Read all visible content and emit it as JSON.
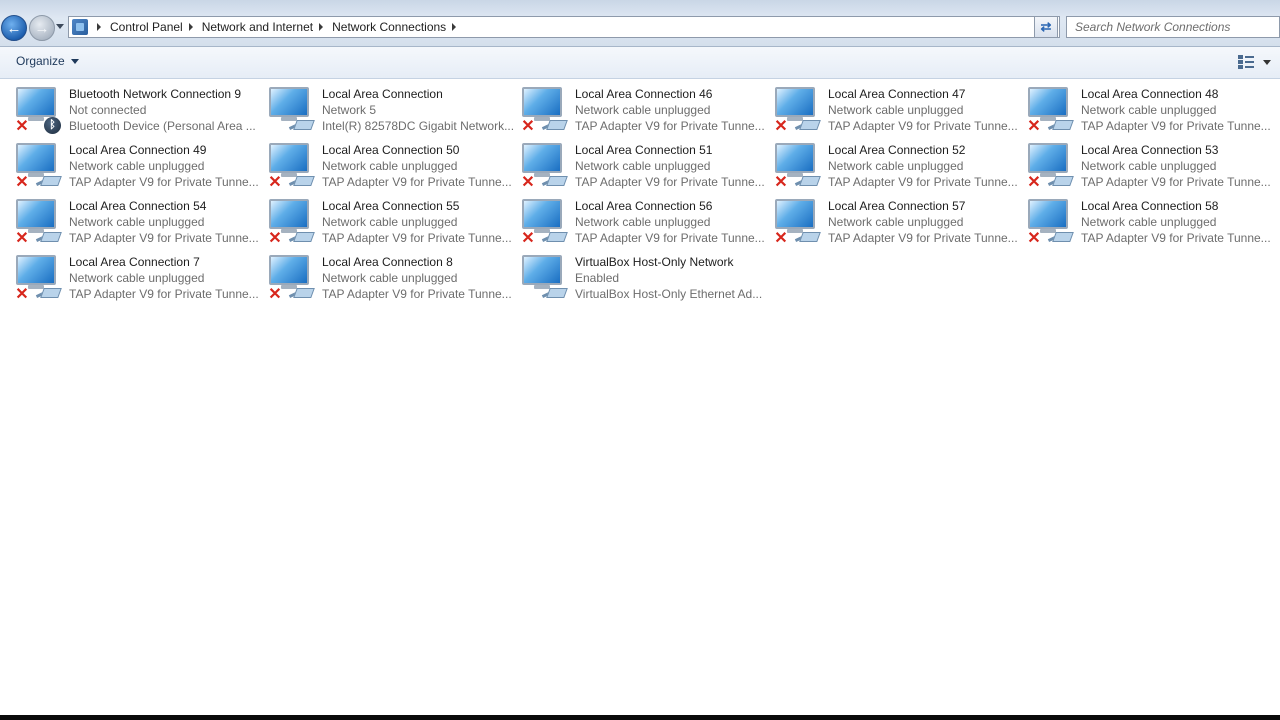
{
  "breadcrumbs": [
    "Control Panel",
    "Network and Internet",
    "Network Connections"
  ],
  "search": {
    "placeholder": "Search Network Connections"
  },
  "toolbar": {
    "organize_label": "Organize"
  },
  "connections": [
    {
      "name": "Bluetooth Network Connection 9",
      "status": "Not connected",
      "device": "Bluetooth Device (Personal Area ...",
      "icon": "bluetooth",
      "disconnected": true
    },
    {
      "name": "Local Area Connection",
      "status": "Network  5",
      "device": "Intel(R) 82578DC Gigabit Network...",
      "icon": "ethernet",
      "disconnected": false
    },
    {
      "name": "Local Area Connection 46",
      "status": "Network cable unplugged",
      "device": "TAP Adapter V9 for Private Tunne...",
      "icon": "ethernet",
      "disconnected": true
    },
    {
      "name": "Local Area Connection 47",
      "status": "Network cable unplugged",
      "device": "TAP Adapter V9 for Private Tunne...",
      "icon": "ethernet",
      "disconnected": true
    },
    {
      "name": "Local Area Connection 48",
      "status": "Network cable unplugged",
      "device": "TAP Adapter V9 for Private Tunne...",
      "icon": "ethernet",
      "disconnected": true
    },
    {
      "name": "Local Area Connection 49",
      "status": "Network cable unplugged",
      "device": "TAP Adapter V9 for Private Tunne...",
      "icon": "ethernet",
      "disconnected": true
    },
    {
      "name": "Local Area Connection 50",
      "status": "Network cable unplugged",
      "device": "TAP Adapter V9 for Private Tunne...",
      "icon": "ethernet",
      "disconnected": true
    },
    {
      "name": "Local Area Connection 51",
      "status": "Network cable unplugged",
      "device": "TAP Adapter V9 for Private Tunne...",
      "icon": "ethernet",
      "disconnected": true
    },
    {
      "name": "Local Area Connection 52",
      "status": "Network cable unplugged",
      "device": "TAP Adapter V9 for Private Tunne...",
      "icon": "ethernet",
      "disconnected": true
    },
    {
      "name": "Local Area Connection 53",
      "status": "Network cable unplugged",
      "device": "TAP Adapter V9 for Private Tunne...",
      "icon": "ethernet",
      "disconnected": true
    },
    {
      "name": "Local Area Connection 54",
      "status": "Network cable unplugged",
      "device": "TAP Adapter V9 for Private Tunne...",
      "icon": "ethernet",
      "disconnected": true
    },
    {
      "name": "Local Area Connection 55",
      "status": "Network cable unplugged",
      "device": "TAP Adapter V9 for Private Tunne...",
      "icon": "ethernet",
      "disconnected": true
    },
    {
      "name": "Local Area Connection 56",
      "status": "Network cable unplugged",
      "device": "TAP Adapter V9 for Private Tunne...",
      "icon": "ethernet",
      "disconnected": true
    },
    {
      "name": "Local Area Connection 57",
      "status": "Network cable unplugged",
      "device": "TAP Adapter V9 for Private Tunne...",
      "icon": "ethernet",
      "disconnected": true
    },
    {
      "name": "Local Area Connection 58",
      "status": "Network cable unplugged",
      "device": "TAP Adapter V9 for Private Tunne...",
      "icon": "ethernet",
      "disconnected": true
    },
    {
      "name": "Local Area Connection 7",
      "status": "Network cable unplugged",
      "device": "TAP Adapter V9 for Private Tunne...",
      "icon": "ethernet",
      "disconnected": true
    },
    {
      "name": "Local Area Connection 8",
      "status": "Network cable unplugged",
      "device": "TAP Adapter V9 for Private Tunne...",
      "icon": "ethernet",
      "disconnected": true
    },
    {
      "name": "VirtualBox Host-Only Network",
      "status": "Enabled",
      "device": "VirtualBox Host-Only Ethernet Ad...",
      "icon": "ethernet",
      "disconnected": false
    }
  ]
}
